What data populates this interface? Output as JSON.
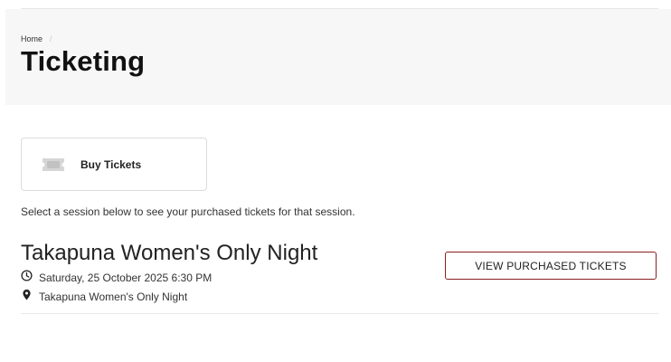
{
  "breadcrumb": {
    "home_label": "Home",
    "separator": "/"
  },
  "page": {
    "title": "Ticketing"
  },
  "buy_card": {
    "label": "Buy Tickets",
    "icon": "ticket-icon"
  },
  "instructions": "Select a session below to see your purchased tickets for that session.",
  "session": {
    "title": "Takapuna Women's Only Night",
    "datetime": "Saturday, 25 October 2025 6:30 PM",
    "datetime_icon": "clock-icon",
    "location": "Takapuna Women's Only Night",
    "location_icon": "map-pin-icon",
    "button_label": "VIEW PURCHASED TICKETS"
  },
  "colors": {
    "accent_border": "#8a1f1f",
    "header_background": "#f7f7f7",
    "divider": "#e6e6e6"
  }
}
